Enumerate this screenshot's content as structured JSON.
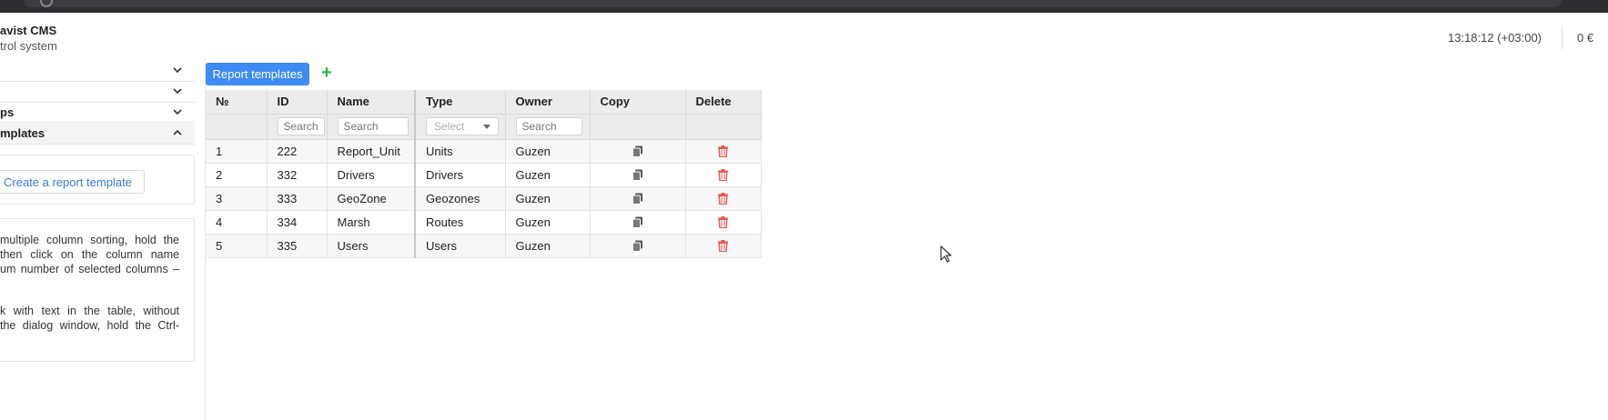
{
  "header": {
    "brand_title": "avist CMS",
    "brand_subtitle": "trol system",
    "clock": "13:18:12 (+03:00)",
    "balance": "0 €"
  },
  "sidebar": {
    "items": [
      {
        "label": ""
      },
      {
        "label": ""
      },
      {
        "label": "ps"
      },
      {
        "label": "mplates"
      }
    ],
    "create_button": "Create a report template",
    "hint_lines": [
      "multiple column sorting, hold the",
      "then click on the column name",
      "um number of selected columns –",
      "",
      "k with text in the table, without",
      "the dialog window, hold the Ctrl-"
    ]
  },
  "main": {
    "tab_label": "Report templates",
    "add_icon": "plus-icon",
    "columns": [
      "№",
      "ID",
      "Name",
      "Type",
      "Owner",
      "Copy",
      "Delete"
    ],
    "filters": {
      "id_placeholder": "Search",
      "name_placeholder": "Search",
      "type_placeholder": "Select",
      "owner_placeholder": "Search"
    },
    "rows": [
      {
        "num": "1",
        "id": "222",
        "name": "Report_Unit",
        "type": "Units",
        "owner": "Guzen"
      },
      {
        "num": "2",
        "id": "332",
        "name": "Drivers",
        "type": "Drivers",
        "owner": "Guzen"
      },
      {
        "num": "3",
        "id": "333",
        "name": "GeoZone",
        "type": "Geozones",
        "owner": "Guzen"
      },
      {
        "num": "4",
        "id": "334",
        "name": "Marsh",
        "type": "Routes",
        "owner": "Guzen"
      },
      {
        "num": "5",
        "id": "335",
        "name": "Users",
        "type": "Users",
        "owner": "Guzen"
      }
    ]
  },
  "colors": {
    "accent": "#3d8bf3",
    "add": "#2fb24a",
    "delete": "#e05a4f",
    "copy": "#555555"
  }
}
